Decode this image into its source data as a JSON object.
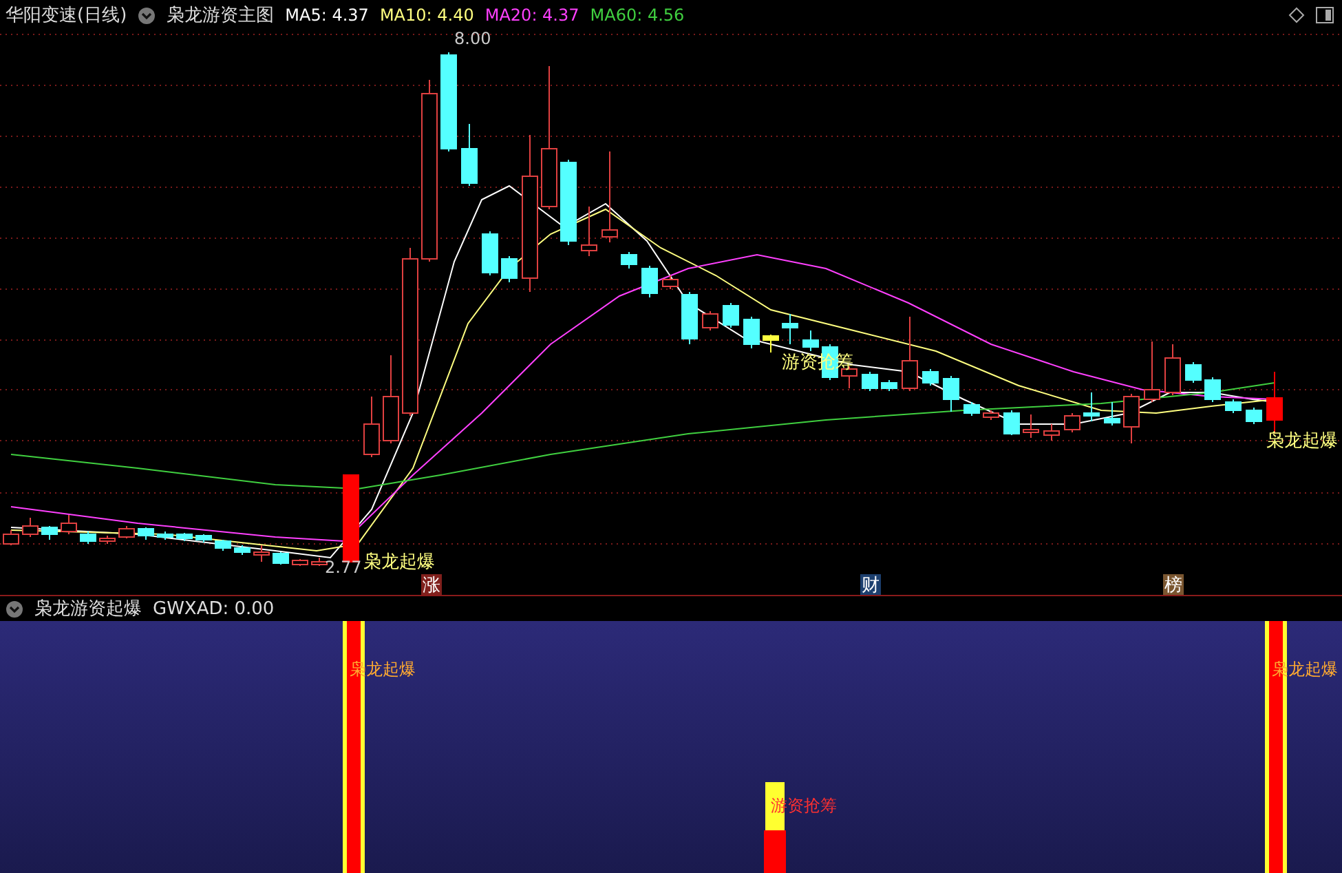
{
  "header": {
    "title": "华阳变速(日线)",
    "indicator": "枭龙游资主图",
    "moving_averages": [
      {
        "label": "MA5: 4.37",
        "color": "#ffffff"
      },
      {
        "label": "MA10: 4.40",
        "color": "#ffff80"
      },
      {
        "label": "MA20: 4.37",
        "color": "#ff40ff"
      },
      {
        "label": "MA60: 4.56",
        "color": "#40d040"
      }
    ]
  },
  "main_chart": {
    "annotations": [
      {
        "kind": "price",
        "text": "8.00"
      },
      {
        "kind": "price",
        "text": "2.77"
      },
      {
        "kind": "signal",
        "text": "枭龙起爆"
      },
      {
        "kind": "signal",
        "text": "游资抢筹"
      },
      {
        "kind": "signal",
        "text": "枭龙起爆"
      }
    ],
    "event_tags": [
      {
        "text": "涨",
        "color": "#80201c"
      },
      {
        "text": "财",
        "color": "#1c3f6e"
      },
      {
        "text": "榜",
        "color": "#7a5630"
      }
    ]
  },
  "sub_chart": {
    "indicator": "枭龙游资起爆",
    "reading": "GWXAD: 0.00",
    "signals": [
      {
        "kind": "burst",
        "label": "枭龙起爆"
      },
      {
        "kind": "accumulate",
        "label": "游资抢筹"
      },
      {
        "kind": "burst",
        "label": "枭龙起爆"
      }
    ]
  }
}
